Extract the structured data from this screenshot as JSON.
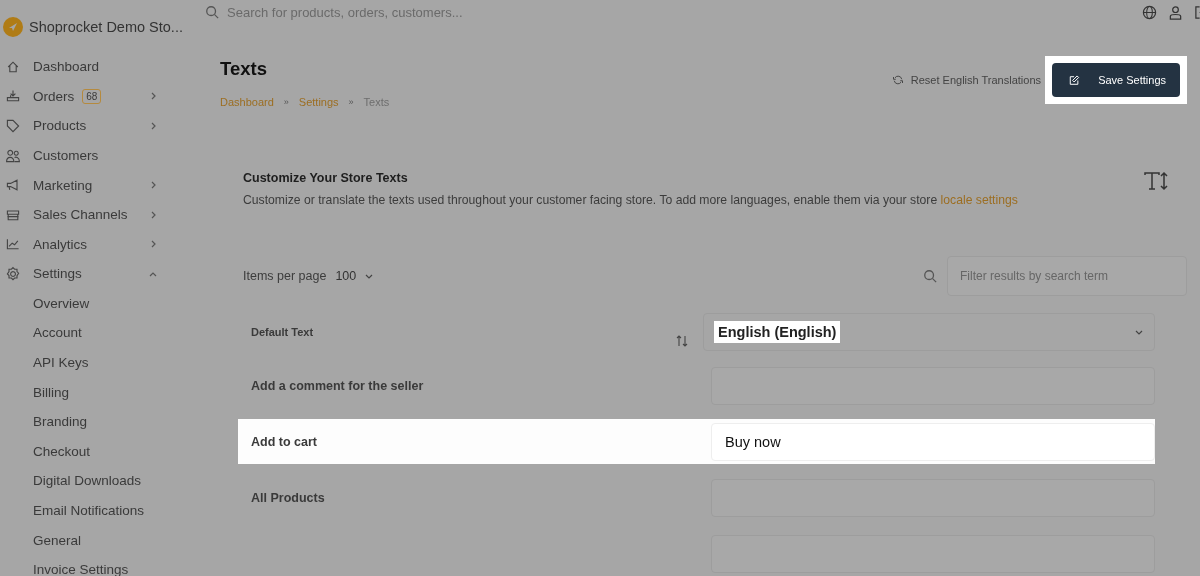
{
  "store": {
    "name": "Shoprocket Demo Sto..."
  },
  "search": {
    "placeholder": "Search for products, orders, customers..."
  },
  "sidebar": {
    "items": [
      {
        "label": "Dashboard",
        "kind": "link"
      },
      {
        "label": "Orders",
        "kind": "group",
        "expanded": false,
        "badge": "68"
      },
      {
        "label": "Products",
        "kind": "group",
        "expanded": false
      },
      {
        "label": "Customers",
        "kind": "link"
      },
      {
        "label": "Marketing",
        "kind": "group",
        "expanded": false
      },
      {
        "label": "Sales Channels",
        "kind": "group",
        "expanded": false
      },
      {
        "label": "Analytics",
        "kind": "group",
        "expanded": false
      },
      {
        "label": "Settings",
        "kind": "group",
        "expanded": true,
        "children": [
          {
            "label": "Overview"
          },
          {
            "label": "Account"
          },
          {
            "label": "API Keys"
          },
          {
            "label": "Billing"
          },
          {
            "label": "Branding"
          },
          {
            "label": "Checkout"
          },
          {
            "label": "Digital Downloads"
          },
          {
            "label": "Email Notifications"
          },
          {
            "label": "General"
          },
          {
            "label": "Invoice Settings"
          }
        ]
      }
    ]
  },
  "page": {
    "title": "Texts",
    "breadcrumbs": [
      {
        "label": "Dashboard",
        "link": true
      },
      {
        "label": "Settings",
        "link": true
      },
      {
        "label": "Texts",
        "link": false
      }
    ],
    "breadcrumb_separators": [
      "»",
      "»"
    ],
    "reset_button": {
      "label": "Reset English Translations"
    },
    "save_button": {
      "label": "Save Settings",
      "highlighted": true
    }
  },
  "card": {
    "heading": "Customize Your Store Texts",
    "description": "Customize or translate the texts used throughout your customer facing store. To add more languages, enable them via your store ",
    "link": "locale settings"
  },
  "pager": {
    "label": "Items per page",
    "value": "100"
  },
  "filter": {
    "placeholder": "Filter results by search term"
  },
  "table": {
    "header": {
      "label": "Default Text"
    },
    "language": {
      "value": "English (English)",
      "highlighted": true
    },
    "rows": [
      {
        "label": "Add a comment for the seller",
        "highlighted": false
      },
      {
        "label": "Add to cart",
        "value": "Buy now",
        "highlighted": true
      },
      {
        "label": "All Products",
        "highlighted": false
      }
    ]
  }
}
